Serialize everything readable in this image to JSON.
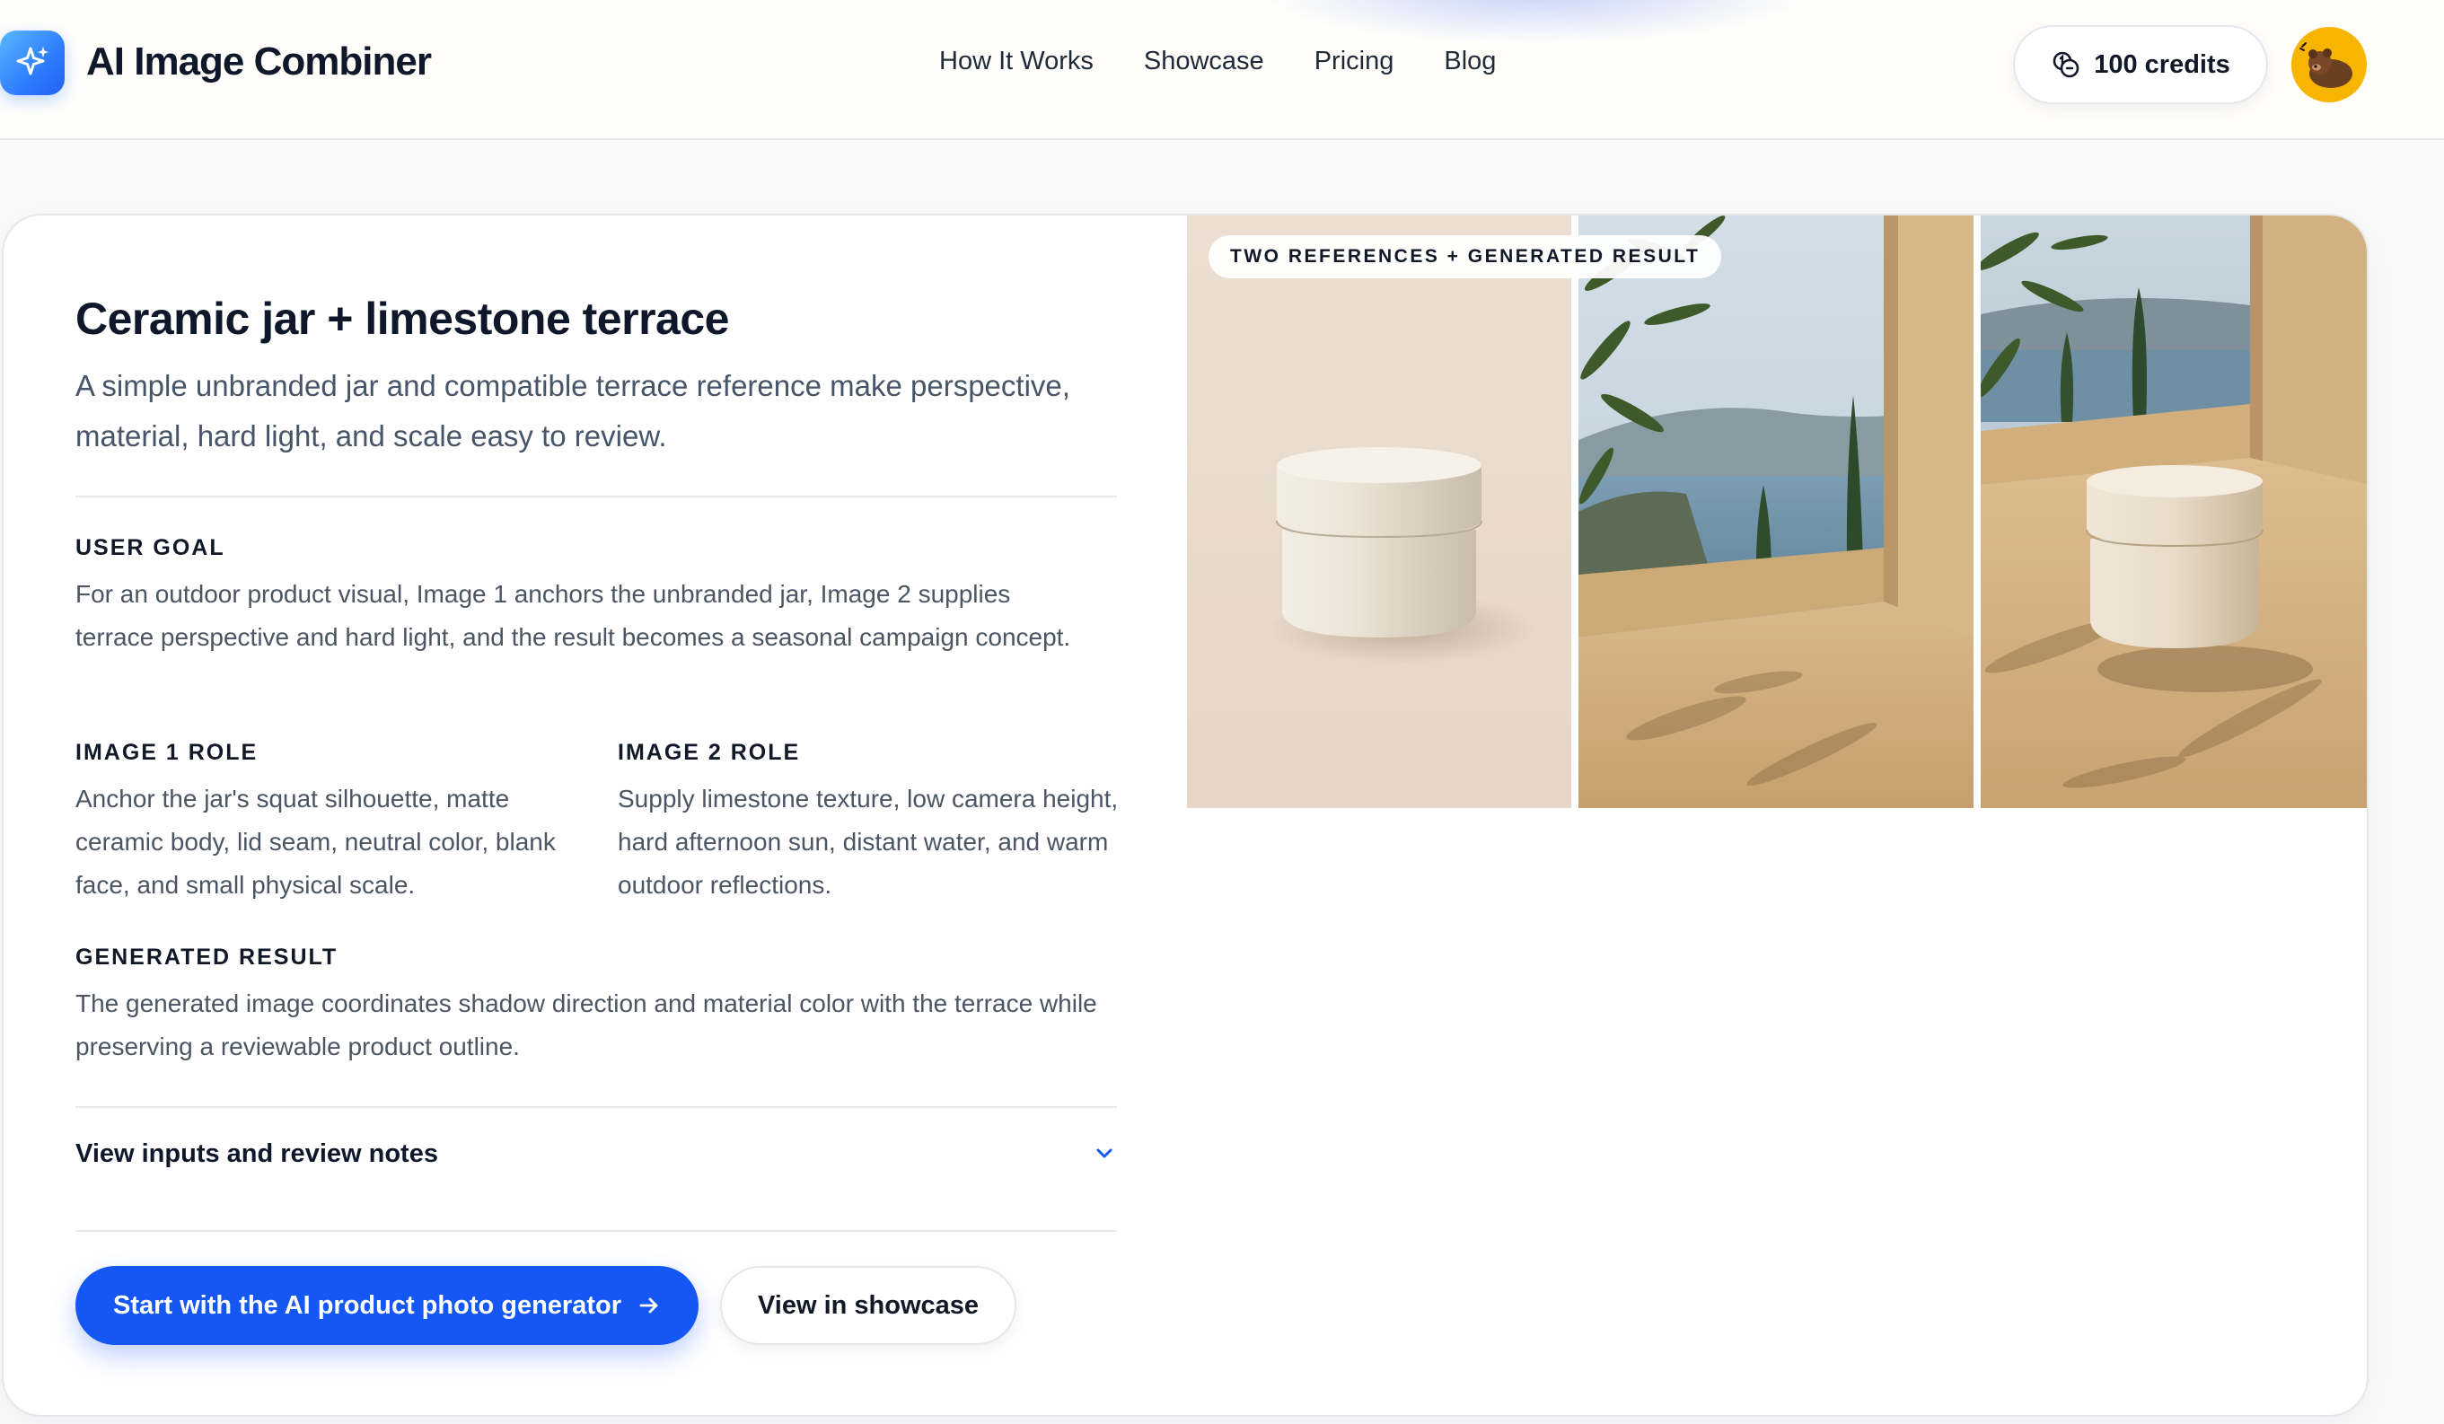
{
  "header": {
    "brand": "AI Image Combiner",
    "logo_icon": "sparkle-icon",
    "nav": [
      "How It Works",
      "Showcase",
      "Pricing",
      "Blog"
    ],
    "credits_label": "100 credits",
    "credits_icon": "coins-icon",
    "avatar_icon": "bear-avatar"
  },
  "card": {
    "title": "Ceramic jar + limestone terrace",
    "subtitle": "A simple unbranded jar and compatible terrace reference make perspective, material, hard light, and scale easy to review.",
    "user_goal_label": "USER GOAL",
    "user_goal_text": "For an outdoor product visual, Image 1 anchors the unbranded jar, Image 2 supplies terrace perspective and hard light, and the result becomes a seasonal campaign concept.",
    "image1_role_label": "IMAGE 1 ROLE",
    "image1_role_text": "Anchor the jar's squat silhouette, matte ceramic body, lid seam, neutral color, blank face, and small physical scale.",
    "image2_role_label": "IMAGE 2 ROLE",
    "image2_role_text": "Supply limestone texture, low camera height, hard afternoon sun, distant water, and warm outdoor reflections.",
    "generated_label": "GENERATED RESULT",
    "generated_text": "The generated image coordinates shadow direction and material color with the terrace while preserving a reviewable product outline.",
    "details_label": "View inputs and review notes",
    "primary_button": "Start with the AI product photo generator",
    "secondary_button": "View in showcase",
    "image_badge": "TWO REFERENCES + GENERATED RESULT"
  },
  "colors": {
    "accent": "#1557f5",
    "text_primary": "#0f172a",
    "text_secondary": "#4b5563",
    "avatar_bg": "#f7b500"
  }
}
